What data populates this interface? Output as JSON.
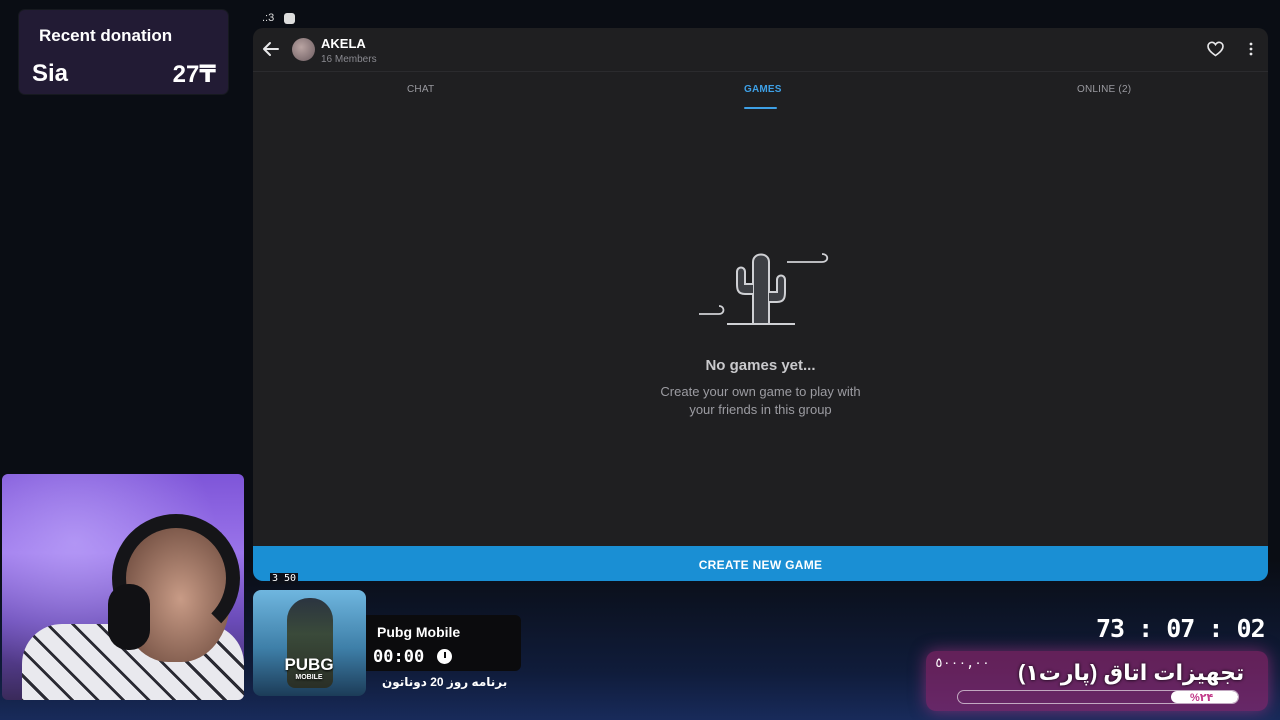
{
  "donation": {
    "title": "Recent donation",
    "donor": "Sia",
    "amount": "27₸"
  },
  "topstrip": {
    "text": ".:3"
  },
  "app": {
    "group_name": "AKELA",
    "group_members": "16 Members",
    "tabs": [
      {
        "label": "CHAT",
        "active": false
      },
      {
        "label": "GAMES",
        "active": true
      },
      {
        "label": "ONLINE (2)",
        "active": false
      }
    ],
    "empty_title": "No games yet...",
    "empty_sub_line1": "Create your own game to play with",
    "empty_sub_line2": "your friends in this group",
    "create_button": "CREATE NEW GAME",
    "accent_color": "#1a8fd4",
    "icons": [
      "back-arrow-icon",
      "heart-icon",
      "more-vertical-icon",
      "cactus-icon"
    ]
  },
  "overlay": {
    "tiny_counter": "3 50",
    "game_name": "Pubg Mobile",
    "game_timer": "00:00",
    "game_logo": "PUBG",
    "game_logo_sub": "MOBILE",
    "schedule": "برنامه روز 20 دوناتون",
    "stream_timer": "73 : 07 : 02",
    "goal_title": "تجهیزات اتاق (پارت۱)",
    "goal_amount": "٥٠٠٠,٠٠",
    "goal_percent_label": "%۲۴",
    "goal_progress": 0.24
  }
}
